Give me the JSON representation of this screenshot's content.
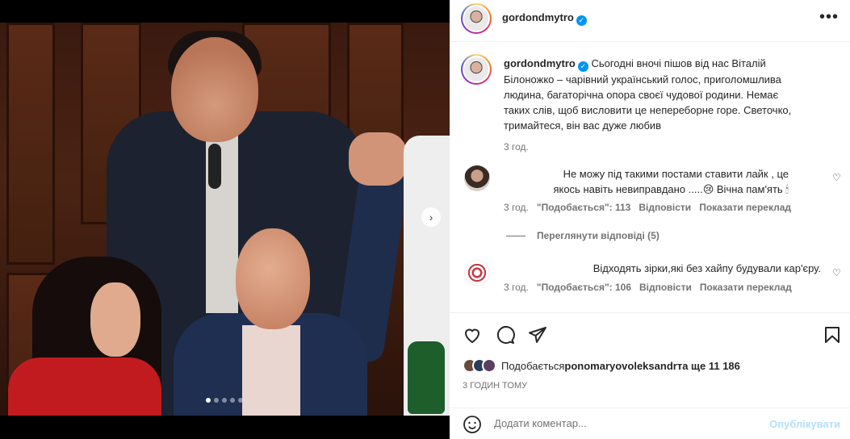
{
  "post": {
    "username": "gordondmytro",
    "caption": "Сьогодні вночі пішов від нас Віталій Білоножко – чарівний український голос, приголомшлива людина, багаторічна опора своєї чудової родини. Немає таких слів, щоб висловити це непереборне горе. Светочко, тримайтеся, він вас дуже любив",
    "caption_age": "3 год.",
    "carousel": {
      "total": 5,
      "current": 1
    }
  },
  "comments": [
    {
      "text": "Не можу під такими постами ставити лайк , це якось навіть невиправдано .....😢 Вічна пам'ять 🕯",
      "age": "3 год.",
      "likes": "\"Подобається\": 113",
      "reply": "Відповісти",
      "translate": "Показати переклад"
    },
    {
      "text": "Відходять зірки,які без хайпу будували кар'єру.",
      "age": "3 год.",
      "likes": "\"Подобається\": 106",
      "reply": "Відповісти",
      "translate": "Показати переклад"
    }
  ],
  "view_replies": "Переглянути відповіді (5)",
  "likes": {
    "prefix": "Подобається",
    "user": "ponomaryovoleksandr",
    "suffix": "та ще 11 186"
  },
  "post_time": "3 ГОДИН ТОМУ",
  "add_comment": {
    "placeholder": "Додати коментар...",
    "publish": "Опублікувати"
  },
  "icons": {
    "verified": "verified-badge-icon",
    "more": "more-options-icon",
    "like": "heart-icon",
    "comment": "comment-icon",
    "share": "share-icon",
    "save": "bookmark-icon",
    "emoji": "emoji-icon"
  },
  "colors": {
    "accent": "#0095f6",
    "publish_disabled": "#b2dffc",
    "meta": "#737373"
  }
}
